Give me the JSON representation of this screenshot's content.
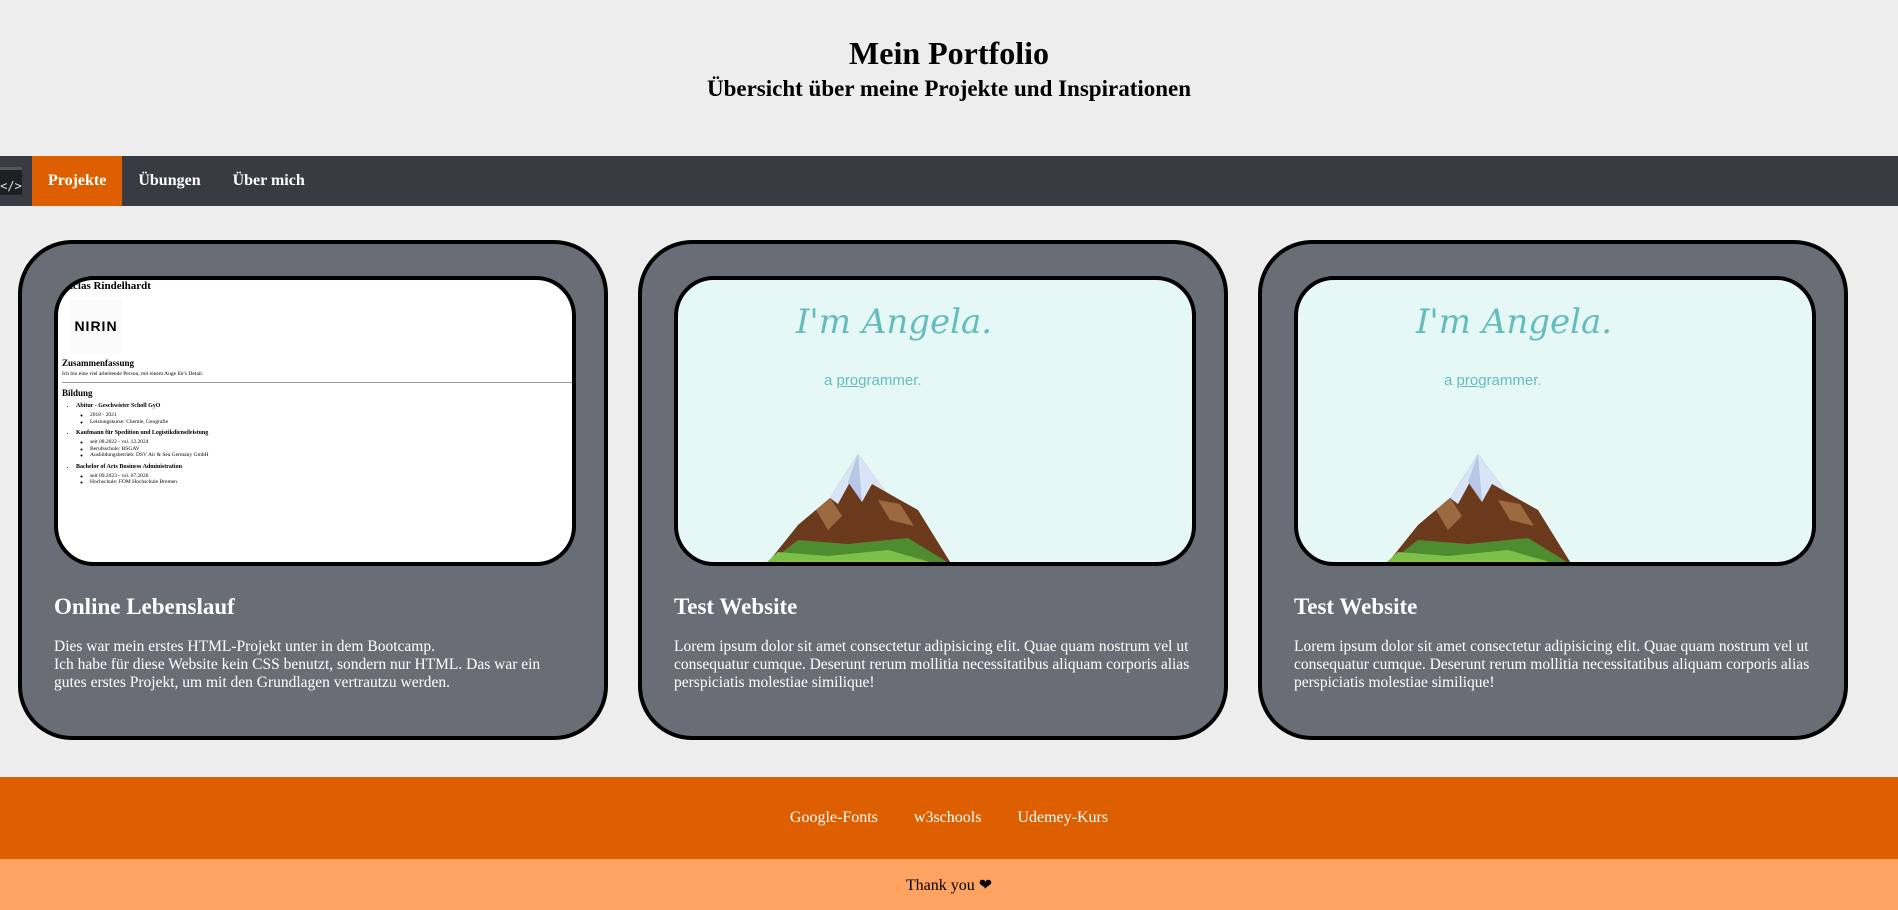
{
  "header": {
    "title": "Mein Portfolio",
    "subtitle": "Übersicht über meine Projekte und Inspirationen"
  },
  "nav": {
    "logo_icon": "code-window-icon",
    "items": [
      {
        "label": "Projekte",
        "active": true
      },
      {
        "label": "Übungen",
        "active": false
      },
      {
        "label": "Über mich",
        "active": false
      }
    ],
    "accent": "#dd5f00",
    "background": "#383b42"
  },
  "cards": [
    {
      "title": "Online Lebenslauf",
      "description_line1": "Dies war mein erstes HTML-Projekt unter in dem Bootcamp.",
      "description_line2": "Ich habe für diese Website kein CSS benutzt, sondern nur HTML. Das war ein gutes erstes Projekt, um mit den Grundlagen vertrautzu werden.",
      "preview": {
        "name": "Niclas Rindelhardt",
        "logo_text": "NIRIN",
        "summary_heading": "Zusammenfassung",
        "summary_text": "Ich bin eine viel arbeitende Person, mit einem Auge für's Detail.",
        "education_heading": "Bildung",
        "education": [
          {
            "title": "Abitur - Geschwister Scholl GyO",
            "details": [
              "2018 - 2021",
              "Leistungskurse: Chemie, Geografie"
            ]
          },
          {
            "title": "Kaufmann für Spedition und Logistikdienstleistung",
            "details": [
              "seit 08.2022 - vsl. 12.2024",
              "Berufsschule: BSGAV",
              "Ausbildungsbetrieb: DSV Air & Sea Germany GmbH"
            ]
          },
          {
            "title": "Bachelor of Arts Business Administration",
            "details": [
              "seit 09.2023 - vsl. 07.2026",
              "Hochschule: FOM Hochschule Bremen"
            ]
          }
        ]
      }
    },
    {
      "title": "Test Website",
      "description": "Lorem ipsum dolor sit amet consectetur adipisicing elit. Quae quam nostrum vel ut consequatur cumque. Deserunt rerum mollitia necessitatibus aliquam corporis alias perspiciatis molestiae similique!",
      "preview": {
        "heading": "I'm Angela.",
        "sub_prefix": "a ",
        "sub_link": "pro",
        "sub_suffix": "grammer."
      }
    },
    {
      "title": "Test Website",
      "description": "Lorem ipsum dolor sit amet consectetur adipisicing elit. Quae quam nostrum vel ut consequatur cumque. Deserunt rerum mollitia necessitatibus aliquam corporis alias perspiciatis molestiae similique!",
      "preview": {
        "heading": "I'm Angela.",
        "sub_prefix": "a ",
        "sub_link": "pro",
        "sub_suffix": "grammer."
      }
    }
  ],
  "footer": {
    "links": [
      "Google-Fonts",
      "w3schools",
      "Udemey-Kurs"
    ],
    "thanks": "Thank you ❤"
  }
}
